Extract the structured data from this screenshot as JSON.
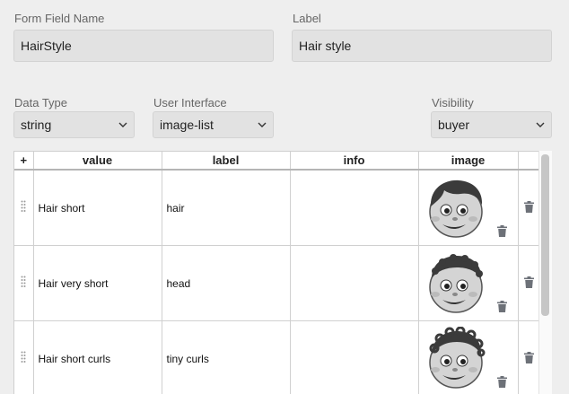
{
  "form": {
    "field_name_label": "Form Field Name",
    "field_name_value": "HairStyle",
    "label_label": "Label",
    "label_value": "Hair style",
    "data_type_label": "Data Type",
    "data_type_value": "string",
    "ui_label": "User Interface",
    "ui_value": "image-list",
    "visibility_label": "Visibility",
    "visibility_value": "buyer"
  },
  "grid": {
    "columns": [
      "+",
      "value",
      "label",
      "info",
      "image"
    ],
    "rows": [
      {
        "value": "Hair short",
        "label": "hair",
        "info": "",
        "image_icon": "cartoon-boy-short-hair-icon"
      },
      {
        "value": "Hair very short",
        "label": "head",
        "info": "",
        "image_icon": "cartoon-boy-very-short-hair-icon"
      },
      {
        "value": "Hair short curls",
        "label": "tiny curls",
        "info": "",
        "image_icon": "cartoon-boy-short-curls-icon"
      }
    ]
  },
  "colors": {
    "background": "#eeeeee",
    "input_bg": "#e2e2e2",
    "icon_gray": "#6d7178"
  }
}
